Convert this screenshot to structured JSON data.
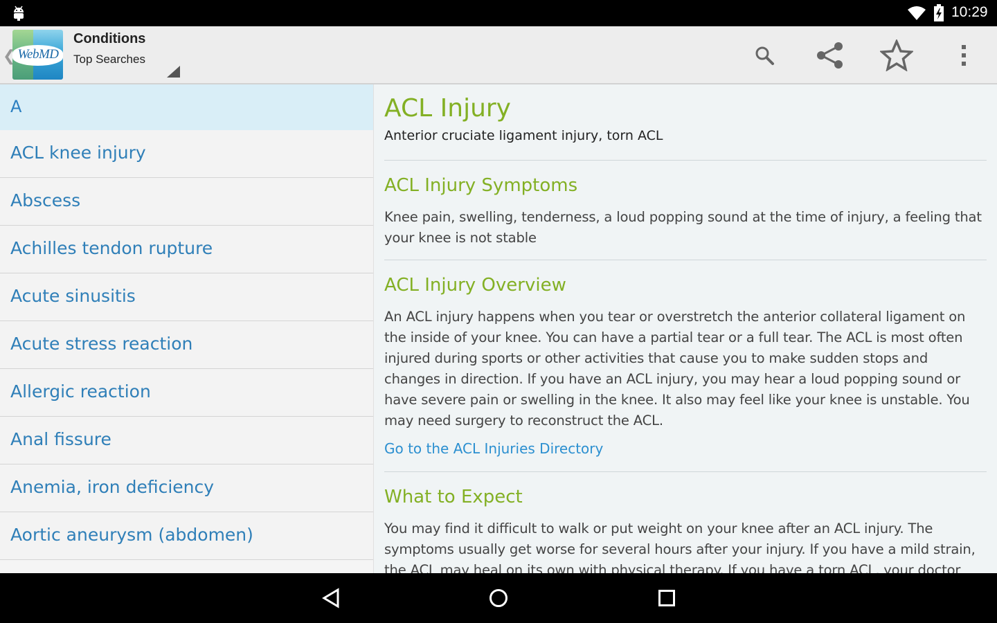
{
  "status_bar": {
    "time": "10:29",
    "icons": [
      "android-debug-icon",
      "wifi-icon",
      "battery-charging-icon"
    ]
  },
  "action_bar": {
    "logo_text": "WebMD",
    "title": "Conditions",
    "subtitle": "Top Searches",
    "actions": [
      "search-icon",
      "share-icon",
      "star-icon",
      "overflow-menu-icon"
    ]
  },
  "list": {
    "section_header": "A",
    "items": [
      "ACL knee injury",
      "Abscess",
      "Achilles tendon rupture",
      "Acute sinusitis",
      "Acute stress reaction",
      "Allergic reaction",
      "Anal fissure",
      "Anemia, iron deficiency",
      "Aortic aneurysm (abdomen)"
    ]
  },
  "detail": {
    "title": "ACL Injury",
    "subtitle": "Anterior cruciate ligament injury, torn ACL",
    "symptoms": {
      "heading": "ACL Injury Symptoms",
      "body": "Knee pain, swelling, tenderness, a loud popping sound at the time of injury, a feeling that your knee is not stable"
    },
    "overview": {
      "heading": "ACL Injury Overview",
      "body": "An ACL injury happens when you tear or overstretch the anterior collateral ligament on the inside of your knee. You can have a partial tear or a full tear. The ACL is most often injured during sports or other activities that cause you to make sudden stops and changes in direction. If you have an ACL injury, you may hear a loud popping sound or have severe pain or swelling in the knee. It also may feel like your knee is unstable. You may need surgery to reconstruct the ACL.",
      "link": "Go to the ACL Injuries Directory"
    },
    "expect": {
      "heading": "What to Expect",
      "body": "You may find it difficult to walk or put weight on your knee after an ACL injury. The symptoms usually get worse for several hours after your injury. If you have a mild strain, the ACL may heal on its own with physical therapy. If you have a torn ACL, your doctor"
    }
  },
  "nav_bar": [
    "back-icon",
    "home-icon",
    "recents-icon"
  ],
  "colors": {
    "accent_green": "#83b024",
    "link_blue": "#2f7fb8",
    "list_header_bg": "#d9eef7"
  }
}
